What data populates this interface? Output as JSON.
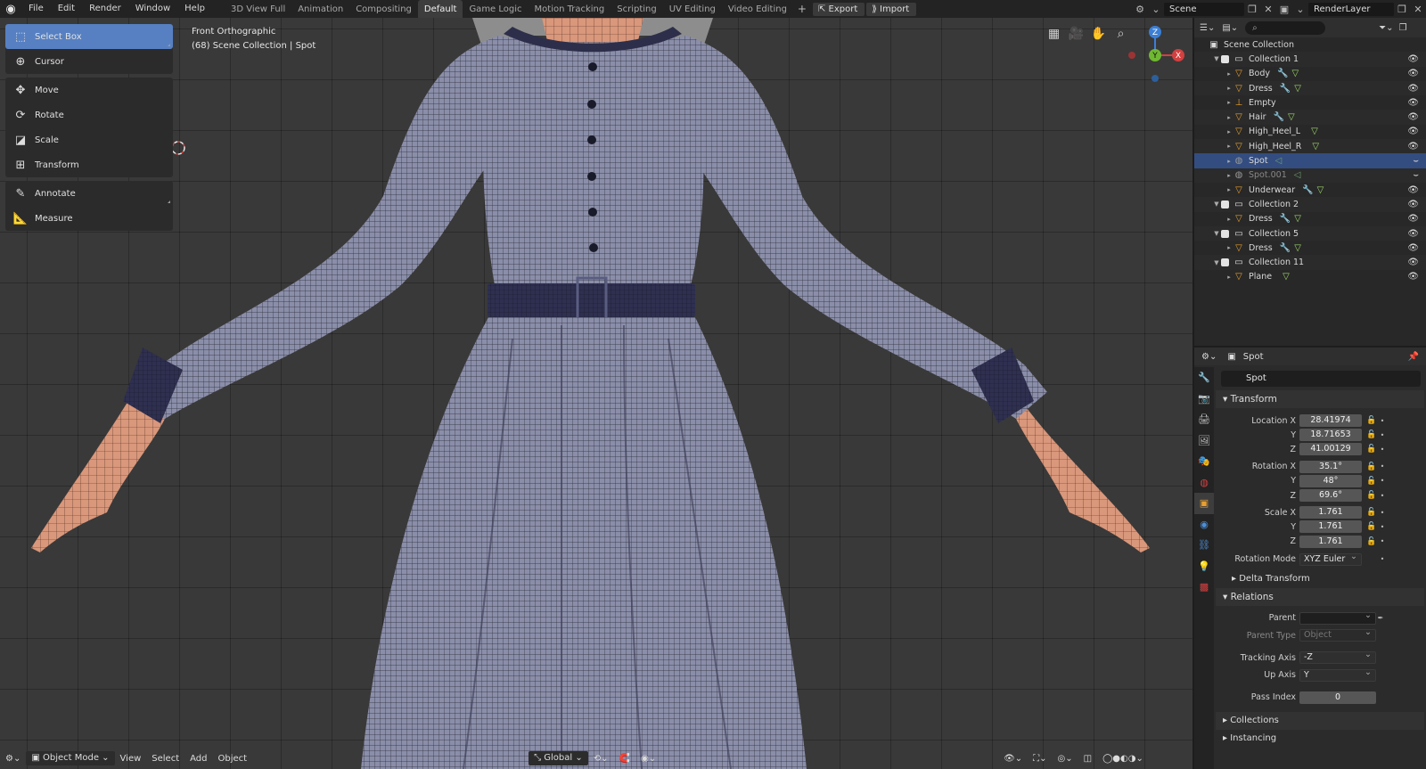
{
  "topbar": {
    "menu": [
      "File",
      "Edit",
      "Render",
      "Window",
      "Help"
    ],
    "workspaces": [
      "3D View Full",
      "Animation",
      "Compositing",
      "Default",
      "Game Logic",
      "Motion Tracking",
      "Scripting",
      "UV Editing",
      "Video Editing"
    ],
    "active_workspace": "Default",
    "export_label": "Export",
    "import_label": "Import",
    "scene": "Scene",
    "render_layer": "RenderLayer"
  },
  "viewport": {
    "view_name": "Front Orthographic",
    "collection_info": "(68) Scene Collection | Spot",
    "tools": [
      "Select Box",
      "Cursor",
      "Move",
      "Rotate",
      "Scale",
      "Transform",
      "Annotate",
      "Measure"
    ],
    "active_tool": "Select Box",
    "gizmo": {
      "z": "Z",
      "y": "Y",
      "x": "X"
    },
    "bottom": {
      "mode": "Object Mode",
      "menus": [
        "View",
        "Select",
        "Add",
        "Object"
      ],
      "orientation": "Global"
    }
  },
  "outliner": {
    "root": "Scene Collection",
    "rows": [
      {
        "label": "Collection 1",
        "kind": "collection"
      },
      {
        "label": "Body",
        "kind": "mesh",
        "mods": true
      },
      {
        "label": "Dress",
        "kind": "mesh",
        "mods": true
      },
      {
        "label": "Empty",
        "kind": "empty"
      },
      {
        "label": "Hair",
        "kind": "mesh",
        "mods": true
      },
      {
        "label": "High_Heel_L",
        "kind": "mesh",
        "mods": false
      },
      {
        "label": "High_Heel_R",
        "kind": "mesh",
        "mods": false
      },
      {
        "label": "Spot",
        "kind": "light",
        "selected": true
      },
      {
        "label": "Spot.001",
        "kind": "light",
        "dim": true
      },
      {
        "label": "Underwear",
        "kind": "mesh",
        "mods": true
      },
      {
        "label": "Collection 2",
        "kind": "collection"
      },
      {
        "label": "Dress",
        "kind": "mesh",
        "mods": true
      },
      {
        "label": "Collection 5",
        "kind": "collection"
      },
      {
        "label": "Dress",
        "kind": "mesh",
        "mods": true
      },
      {
        "label": "Collection 11",
        "kind": "collection"
      },
      {
        "label": "Plane",
        "kind": "mesh",
        "mods": false
      }
    ]
  },
  "properties": {
    "header_object": "Spot",
    "object_name": "Spot",
    "transform_title": "Transform",
    "location_label": "Location X",
    "location": [
      "28.41974",
      "18.71653",
      "41.00129"
    ],
    "rotation_label": "Rotation X",
    "rotation": [
      "35.1°",
      "48°",
      "69.6°"
    ],
    "scale_label": "Scale X",
    "scale": [
      "1.761",
      "1.761",
      "1.761"
    ],
    "axis_y": "Y",
    "axis_z": "Z",
    "rotation_mode_label": "Rotation Mode",
    "rotation_mode": "XYZ Euler",
    "delta_transform": "Delta Transform",
    "relations_title": "Relations",
    "parent_label": "Parent",
    "parent_type_label": "Parent Type",
    "parent_type": "Object",
    "tracking_axis_label": "Tracking Axis",
    "tracking_axis": "-Z",
    "up_axis_label": "Up Axis",
    "up_axis": "Y",
    "pass_index_label": "Pass Index",
    "pass_index": "0",
    "collections": "Collections",
    "instancing": "Instancing"
  }
}
